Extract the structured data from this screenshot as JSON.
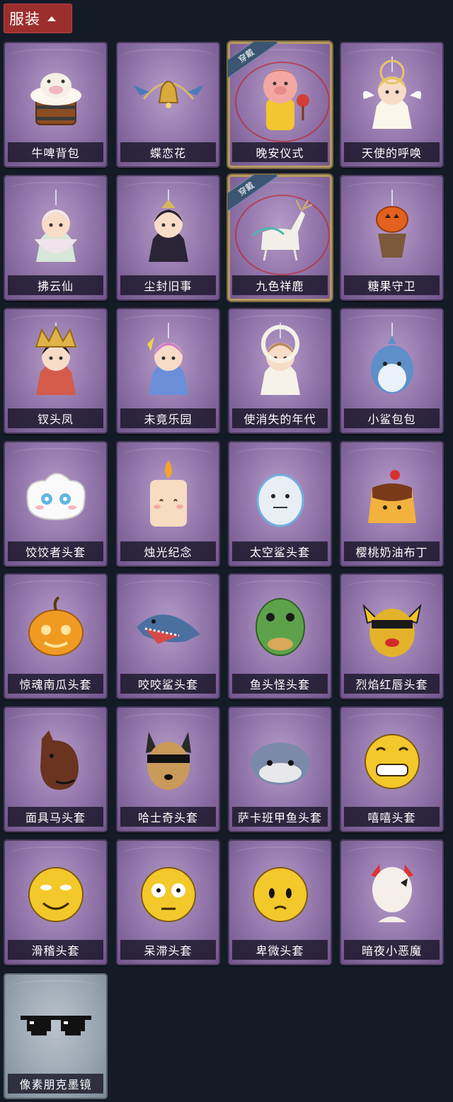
{
  "header": {
    "label": "服装"
  },
  "equipped_badge": "穿戴",
  "items": [
    {
      "name": "牛啤背包",
      "icon": "beer-cow-bag-icon",
      "equipped": false
    },
    {
      "name": "蝶恋花",
      "icon": "butterfly-bell-icon",
      "equipped": false
    },
    {
      "name": "晚安仪式",
      "icon": "pig-character-icon",
      "equipped": true
    },
    {
      "name": "天使的呼唤",
      "icon": "angel-icon",
      "equipped": false
    },
    {
      "name": "拂云仙",
      "icon": "cloud-fairy-icon",
      "equipped": false
    },
    {
      "name": "尘封旧事",
      "icon": "gentleman-icon",
      "equipped": false
    },
    {
      "name": "九色祥鹿",
      "icon": "deer-icon",
      "equipped": true
    },
    {
      "name": "糖果守卫",
      "icon": "pumpkin-guard-icon",
      "equipped": false
    },
    {
      "name": "钗头凤",
      "icon": "phoenix-crown-icon",
      "equipped": false
    },
    {
      "name": "未竟乐园",
      "icon": "wizard-girl-icon",
      "equipped": false
    },
    {
      "name": "使消失的年代",
      "icon": "veiled-doll-icon",
      "equipped": false
    },
    {
      "name": "小鲨包包",
      "icon": "shark-bag-icon",
      "equipped": false
    },
    {
      "name": "饺饺者头套",
      "icon": "dumpling-head-icon",
      "equipped": false
    },
    {
      "name": "烛光纪念",
      "icon": "candle-head-icon",
      "equipped": false
    },
    {
      "name": "太空鲨头套",
      "icon": "space-shark-head-icon",
      "equipped": false
    },
    {
      "name": "樱桃奶油布丁",
      "icon": "pudding-head-icon",
      "equipped": false
    },
    {
      "name": "惊魂南瓜头套",
      "icon": "pumpkin-head-icon",
      "equipped": false
    },
    {
      "name": "咬咬鲨头套",
      "icon": "shark-head-icon",
      "equipped": false
    },
    {
      "name": "鱼头怪头套",
      "icon": "fish-head-icon",
      "equipped": false
    },
    {
      "name": "烈焰红唇头套",
      "icon": "red-lips-head-icon",
      "equipped": false
    },
    {
      "name": "面具马头套",
      "icon": "horse-head-icon",
      "equipped": false
    },
    {
      "name": "哈士奇头套",
      "icon": "husky-head-icon",
      "equipped": false
    },
    {
      "name": "萨卡班甲鱼头套",
      "icon": "sacabambaspis-head-icon",
      "equipped": false
    },
    {
      "name": "嘻嘻头套",
      "icon": "grin-emoji-head-icon",
      "equipped": false
    },
    {
      "name": "滑稽头套",
      "icon": "funny-emoji-head-icon",
      "equipped": false
    },
    {
      "name": "呆滞头套",
      "icon": "dazed-emoji-head-icon",
      "equipped": false
    },
    {
      "name": "卑微头套",
      "icon": "pleading-emoji-head-icon",
      "equipped": false
    },
    {
      "name": "暗夜小恶魔",
      "icon": "little-devil-icon",
      "equipped": false
    },
    {
      "name": "像素朋克墨镜",
      "icon": "pixel-sunglasses-icon",
      "equipped": false
    }
  ],
  "colors": {
    "background": "#141b27",
    "header": "#9c2f2d",
    "card_purple": "#8f72a8",
    "card_grey": "#97a4b0",
    "equipped_border": "#b69a62"
  }
}
